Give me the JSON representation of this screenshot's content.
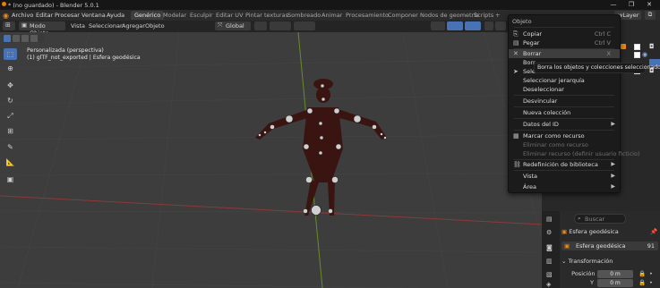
{
  "window": {
    "title": "* (no guardado) - Blender 5.0.1",
    "controls": [
      "minimize-icon",
      "maximize-icon",
      "close-icon"
    ]
  },
  "menubar": {
    "menus": [
      "Archivo",
      "Editar",
      "Procesar",
      "Ventana",
      "Ayuda"
    ],
    "workspaces": [
      "Genérico",
      "Modelar",
      "Esculpir",
      "Editar UV",
      "Pintar texturas",
      "Sombreado",
      "Animar",
      "Procesamiento",
      "Componer",
      "Nodos de geometría",
      "Scripts"
    ],
    "active_workspace": "Genérico",
    "add_tab": "+",
    "view_layer": "wLayer"
  },
  "viewport_header": {
    "mode": "Modo Objeto",
    "menus": [
      "Vista",
      "Seleccionar",
      "Agregar",
      "Objeto"
    ],
    "orientation": "Global"
  },
  "viewport": {
    "view_name": "Personalizada (perspectiva)",
    "object_info": "(1) glTF_not_exported | Esfera geodésica"
  },
  "context_menu": {
    "title": "Objeto",
    "items": [
      {
        "label": "Copiar",
        "shortcut": "Ctrl C",
        "icon": "copy-icon"
      },
      {
        "label": "Pegar",
        "shortcut": "Ctrl V",
        "icon": "paste-icon"
      },
      {
        "label": "Borrar",
        "shortcut": "X",
        "icon": "delete-icon",
        "highlighted": true
      },
      {
        "label": "Borrar jerarquía",
        "partial": true
      },
      {
        "label": "Seleccionar",
        "icon": "cursor-icon",
        "partial": true
      },
      {
        "label": "Seleccionar jerarquía"
      },
      {
        "label": "Deseleccionar"
      },
      {
        "label": "Desvincular"
      },
      {
        "label": "Nueva colección"
      },
      {
        "label": "Datos del ID",
        "submenu": true
      },
      {
        "label": "Marcar como recurso",
        "icon": "asset-icon"
      },
      {
        "label": "Eliminar como recurso",
        "disabled": true
      },
      {
        "label": "Eliminar recurso (definir usuario ficticio)",
        "disabled": true
      },
      {
        "label": "Redefinición de biblioteca",
        "icon": "library-override-icon",
        "submenu": true
      },
      {
        "label": "Vista",
        "submenu": true
      },
      {
        "label": "Área",
        "submenu": true
      }
    ],
    "tooltip": "Borra los objetos y colecciones seleccionados."
  },
  "properties": {
    "search_placeholder": "Buscar",
    "object_name": "Esfera geodésica",
    "data_name": "Esfera geodésica",
    "data_users": "91",
    "section": "Transformación",
    "location_x_label": "Posición X",
    "location_x": "0 m",
    "location_y_label": "Y",
    "location_y": "0 m"
  },
  "colors": {
    "accent": "#4772b3",
    "menu_bg": "#1b1b1b",
    "viewport_bg": "#3d3d3d",
    "x_axis": "#8b3a3a",
    "y_axis": "#6b8b2a",
    "armature_body": "#3a1410"
  }
}
